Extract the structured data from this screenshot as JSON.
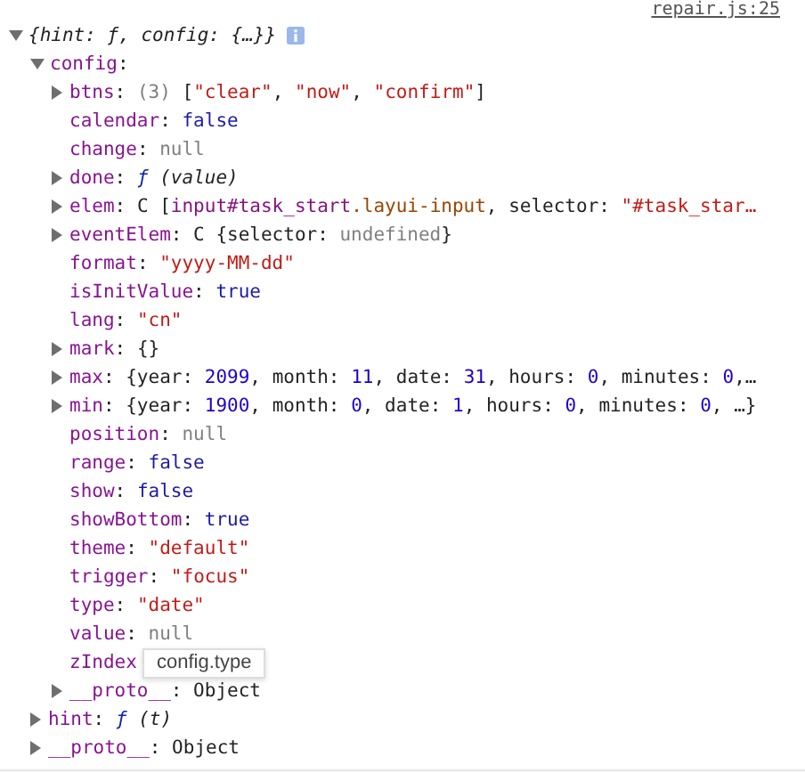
{
  "source_link": "repair.js:25",
  "root": {
    "expanded": true,
    "tokens": [
      {
        "kind": "summary",
        "text": "{hint: ƒ, config: {…}}"
      }
    ],
    "children": [
      {
        "expanded": true,
        "tokens": [
          {
            "kind": "key",
            "text": "config"
          },
          {
            "kind": "punct",
            "text": ":"
          }
        ],
        "children": [
          {
            "expanded": false,
            "tokens": [
              {
                "kind": "key",
                "text": "btns"
              },
              {
                "kind": "punct",
                "text": ": "
              },
              {
                "kind": "meta",
                "text": "(3) "
              },
              {
                "kind": "punct",
                "text": "["
              },
              {
                "kind": "string",
                "text": "\"clear\""
              },
              {
                "kind": "punct",
                "text": ", "
              },
              {
                "kind": "string",
                "text": "\"now\""
              },
              {
                "kind": "punct",
                "text": ", "
              },
              {
                "kind": "string",
                "text": "\"confirm\""
              },
              {
                "kind": "punct",
                "text": "]"
              }
            ]
          },
          {
            "tokens": [
              {
                "kind": "key",
                "text": "calendar"
              },
              {
                "kind": "punct",
                "text": ": "
              },
              {
                "kind": "keyword",
                "text": "false"
              }
            ]
          },
          {
            "tokens": [
              {
                "kind": "key",
                "text": "change"
              },
              {
                "kind": "punct",
                "text": ": "
              },
              {
                "kind": "null",
                "text": "null"
              }
            ]
          },
          {
            "expanded": false,
            "tokens": [
              {
                "kind": "key",
                "text": "done"
              },
              {
                "kind": "punct",
                "text": ": "
              },
              {
                "kind": "func",
                "text": "ƒ"
              },
              {
                "kind": "italic",
                "text": " (value)"
              }
            ]
          },
          {
            "expanded": false,
            "tokens": [
              {
                "kind": "key",
                "text": "elem"
              },
              {
                "kind": "punct",
                "text": ": C ["
              },
              {
                "kind": "tag",
                "text": "input#task_start"
              },
              {
                "kind": "cls",
                "text": ".layui-input"
              },
              {
                "kind": "punct",
                "text": ", selector: "
              },
              {
                "kind": "string",
                "text": "\"#task_star…"
              }
            ]
          },
          {
            "expanded": false,
            "tokens": [
              {
                "kind": "key",
                "text": "eventElem"
              },
              {
                "kind": "punct",
                "text": ": C {selector: "
              },
              {
                "kind": "null",
                "text": "undefined"
              },
              {
                "kind": "punct",
                "text": "}"
              }
            ]
          },
          {
            "tokens": [
              {
                "kind": "key",
                "text": "format"
              },
              {
                "kind": "punct",
                "text": ": "
              },
              {
                "kind": "string",
                "text": "\"yyyy-MM-dd\""
              }
            ]
          },
          {
            "tokens": [
              {
                "kind": "key",
                "text": "isInitValue"
              },
              {
                "kind": "punct",
                "text": ": "
              },
              {
                "kind": "keyword",
                "text": "true"
              }
            ]
          },
          {
            "tokens": [
              {
                "kind": "key",
                "text": "lang"
              },
              {
                "kind": "punct",
                "text": ": "
              },
              {
                "kind": "string",
                "text": "\"cn\""
              }
            ]
          },
          {
            "expanded": false,
            "tokens": [
              {
                "kind": "key",
                "text": "mark"
              },
              {
                "kind": "punct",
                "text": ": {}"
              }
            ]
          },
          {
            "expanded": false,
            "tokens": [
              {
                "kind": "key",
                "text": "max"
              },
              {
                "kind": "punct",
                "text": ": {year: "
              },
              {
                "kind": "number",
                "text": "2099"
              },
              {
                "kind": "punct",
                "text": ", month: "
              },
              {
                "kind": "number",
                "text": "11"
              },
              {
                "kind": "punct",
                "text": ", date: "
              },
              {
                "kind": "number",
                "text": "31"
              },
              {
                "kind": "punct",
                "text": ", hours: "
              },
              {
                "kind": "number",
                "text": "0"
              },
              {
                "kind": "punct",
                "text": ", minutes: "
              },
              {
                "kind": "number",
                "text": "0"
              },
              {
                "kind": "punct",
                "text": ",…"
              }
            ]
          },
          {
            "expanded": false,
            "tokens": [
              {
                "kind": "key",
                "text": "min"
              },
              {
                "kind": "punct",
                "text": ": {year: "
              },
              {
                "kind": "number",
                "text": "1900"
              },
              {
                "kind": "punct",
                "text": ", month: "
              },
              {
                "kind": "number",
                "text": "0"
              },
              {
                "kind": "punct",
                "text": ", date: "
              },
              {
                "kind": "number",
                "text": "1"
              },
              {
                "kind": "punct",
                "text": ", hours: "
              },
              {
                "kind": "number",
                "text": "0"
              },
              {
                "kind": "punct",
                "text": ", minutes: "
              },
              {
                "kind": "number",
                "text": "0"
              },
              {
                "kind": "punct",
                "text": ", …}"
              }
            ]
          },
          {
            "tokens": [
              {
                "kind": "key",
                "text": "position"
              },
              {
                "kind": "punct",
                "text": ": "
              },
              {
                "kind": "null",
                "text": "null"
              }
            ]
          },
          {
            "tokens": [
              {
                "kind": "key",
                "text": "range"
              },
              {
                "kind": "punct",
                "text": ": "
              },
              {
                "kind": "keyword",
                "text": "false"
              }
            ]
          },
          {
            "tokens": [
              {
                "kind": "key",
                "text": "show"
              },
              {
                "kind": "punct",
                "text": ": "
              },
              {
                "kind": "keyword",
                "text": "false"
              }
            ]
          },
          {
            "tokens": [
              {
                "kind": "key",
                "text": "showBottom"
              },
              {
                "kind": "punct",
                "text": ": "
              },
              {
                "kind": "keyword",
                "text": "true"
              }
            ]
          },
          {
            "tokens": [
              {
                "kind": "key",
                "text": "theme"
              },
              {
                "kind": "punct",
                "text": ": "
              },
              {
                "kind": "string",
                "text": "\"default\""
              }
            ]
          },
          {
            "tokens": [
              {
                "kind": "key",
                "text": "trigger"
              },
              {
                "kind": "punct",
                "text": ": "
              },
              {
                "kind": "string",
                "text": "\"focus\""
              }
            ]
          },
          {
            "tokens": [
              {
                "kind": "key",
                "text": "type"
              },
              {
                "kind": "punct",
                "text": ": "
              },
              {
                "kind": "string",
                "text": "\"date\""
              }
            ]
          },
          {
            "tokens": [
              {
                "kind": "key",
                "text": "value"
              },
              {
                "kind": "punct",
                "text": ": "
              },
              {
                "kind": "null",
                "text": "null"
              }
            ]
          },
          {
            "tokens": [
              {
                "kind": "key",
                "text": "zIndex"
              }
            ]
          },
          {
            "expanded": false,
            "tokens": [
              {
                "kind": "key",
                "text": "__proto__"
              },
              {
                "kind": "punct",
                "text": ": Object"
              }
            ]
          }
        ]
      },
      {
        "expanded": false,
        "tokens": [
          {
            "kind": "key",
            "text": "hint"
          },
          {
            "kind": "punct",
            "text": ": "
          },
          {
            "kind": "func",
            "text": "ƒ"
          },
          {
            "kind": "italic",
            "text": " (t)"
          }
        ]
      },
      {
        "expanded": false,
        "tokens": [
          {
            "kind": "key",
            "text": "__proto__"
          },
          {
            "kind": "punct",
            "text": ": Object"
          }
        ]
      }
    ]
  },
  "tooltip": {
    "text": "config.type"
  }
}
